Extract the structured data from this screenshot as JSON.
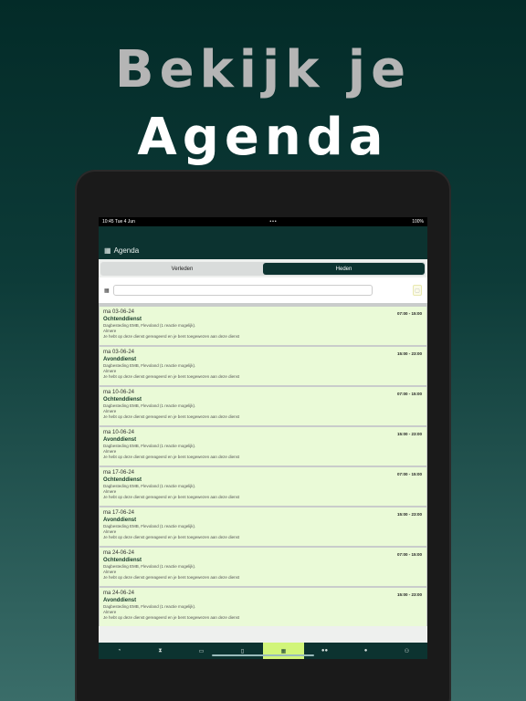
{
  "headline": {
    "line1": "Bekijk je",
    "line2": "Agenda"
  },
  "statusbar": {
    "time": "10:45",
    "date": "Tue 4 Jun",
    "dots": "•••",
    "battery": "100%"
  },
  "appbar": {
    "icon": "calendar-icon",
    "title": "Agenda"
  },
  "segments": {
    "past": "Verleden",
    "today": "Heden",
    "active": "Heden"
  },
  "filter": {
    "icon": "calendar-icon",
    "value": ""
  },
  "items": [
    {
      "date": "ma 03-06-24",
      "time": "07:00 - 15:00",
      "shift": "Ochtenddienst",
      "line1": "Dagbesteding EMB, Flevoland (1 reactie mogelijk).",
      "line2": "Almere",
      "line3": "Je hebt op deze dienst gereageerd en je bent toegewezen aan deze dienst"
    },
    {
      "date": "ma 03-06-24",
      "time": "15:00 - 23:00",
      "shift": "Avonddienst",
      "line1": "Dagbesteding EMB, Flevoland (1 reactie mogelijk).",
      "line2": "Almere",
      "line3": "Je hebt op deze dienst gereageerd en je bent toegewezen aan deze dienst"
    },
    {
      "date": "ma 10-06-24",
      "time": "07:00 - 15:00",
      "shift": "Ochtenddienst",
      "line1": "Dagbesteding EMB, Flevoland (1 reactie mogelijk).",
      "line2": "Almere",
      "line3": "Je hebt op deze dienst gereageerd en je bent toegewezen aan deze dienst"
    },
    {
      "date": "ma 10-06-24",
      "time": "15:00 - 23:00",
      "shift": "Avonddienst",
      "line1": "Dagbesteding EMB, Flevoland (1 reactie mogelijk).",
      "line2": "Almere",
      "line3": "Je hebt op deze dienst gereageerd en je bent toegewezen aan deze dienst"
    },
    {
      "date": "ma 17-06-24",
      "time": "07:00 - 15:00",
      "shift": "Ochtenddienst",
      "line1": "Dagbesteding EMB, Flevoland (1 reactie mogelijk).",
      "line2": "Almere",
      "line3": "Je hebt op deze dienst gereageerd en je bent toegewezen aan deze dienst"
    },
    {
      "date": "ma 17-06-24",
      "time": "15:00 - 23:00",
      "shift": "Avonddienst",
      "line1": "Dagbesteding EMB, Flevoland (1 reactie mogelijk).",
      "line2": "Almere",
      "line3": "Je hebt op deze dienst gereageerd en je bent toegewezen aan deze dienst"
    },
    {
      "date": "ma 24-06-24",
      "time": "07:00 - 15:00",
      "shift": "Ochtenddienst",
      "line1": "Dagbesteding EMB, Flevoland (1 reactie mogelijk).",
      "line2": "Almere",
      "line3": "Je hebt op deze dienst gereageerd en je bent toegewezen aan deze dienst"
    },
    {
      "date": "ma 24-06-24",
      "time": "15:00 - 23:00",
      "shift": "Avonddienst",
      "line1": "Dagbesteding EMB, Flevoland (1 reactie mogelijk).",
      "line2": "Almere",
      "line3": "Je hebt op deze dienst gereageerd en je bent toegewezen aan deze dienst"
    }
  ],
  "nav": [
    {
      "icon": "dashboard-icon",
      "glyph": "◔"
    },
    {
      "icon": "hourglass-icon",
      "glyph": "⧗"
    },
    {
      "icon": "id-card-icon",
      "glyph": "▭"
    },
    {
      "icon": "clipboard-icon",
      "glyph": "▯"
    },
    {
      "icon": "calendar-icon",
      "glyph": "▦",
      "active": true
    },
    {
      "icon": "users-icon",
      "glyph": "●●"
    },
    {
      "icon": "chat-icon",
      "glyph": "●"
    },
    {
      "icon": "person-icon",
      "glyph": "⚇"
    }
  ],
  "colors": {
    "brand": "#0c3330",
    "accent": "#d1f57a",
    "card": "#eafad7"
  }
}
